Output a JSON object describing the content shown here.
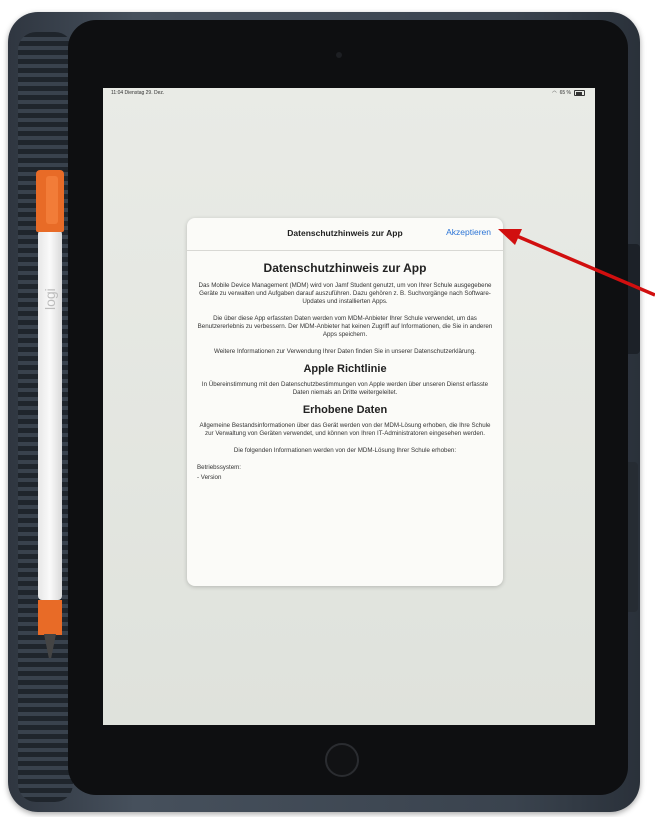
{
  "status_bar": {
    "time_date": "11:04 Dienstag 29. Dez.",
    "battery": "65 %"
  },
  "dialog": {
    "header_title": "Datenschutzhinweis zur App",
    "accept_label": "Akzeptieren",
    "heading_main": "Datenschutzhinweis zur App",
    "para1": "Das Mobile Device Management (MDM) wird von Jamf Student genutzt, um von Ihrer Schule ausgegebene Geräte zu verwalten und Aufgaben darauf auszuführen. Dazu gehören z. B. Suchvorgänge nach Software-Updates und installierten Apps.",
    "para2": "Die über diese App erfassten Daten werden vom MDM-Anbieter Ihrer Schule verwendet, um das Benutzererlebnis zu verbessern. Der MDM-Anbieter hat keinen Zugriff auf Informationen, die Sie in anderen Apps speichern.",
    "para3": "Weitere Informationen zur Verwendung Ihrer Daten finden Sie in unserer Datenschutzerklärung.",
    "heading_apple": "Apple Richtlinie",
    "para4": "In Übereinstimmung mit den Datenschutzbestimmungen von Apple werden über unseren Dienst erfasste Daten niemals an Dritte weitergeleitet.",
    "heading_collected": "Erhobene Daten",
    "para5": "Allgemeine Bestandsinformationen über das Gerät werden von der MDM-Lösung erhoben, die Ihre Schule zur Verwaltung von Geräten verwendet, und können von Ihren IT-Administratoren eingesehen werden.",
    "para6": "Die folgenden Informationen werden von der MDM-Lösung Ihrer Schule erhoben:",
    "os_label": "Betriebssystem:",
    "os_item": "- Version"
  },
  "pencil": {
    "logo": "logi"
  },
  "colors": {
    "accent": "#2b74d6",
    "arrow": "#d10f0f",
    "pencil_orange": "#e86b27"
  }
}
